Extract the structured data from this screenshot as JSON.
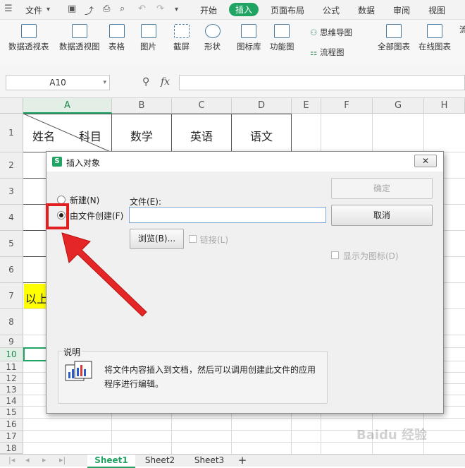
{
  "menu": {
    "file": "文件",
    "tabs": [
      "开始",
      "插入",
      "页面布局",
      "公式",
      "数据",
      "审阅",
      "视图"
    ],
    "active_tab": "插入"
  },
  "ribbon": {
    "pivot_table": "数据透视表",
    "pivot_chart": "数据透视图",
    "table": "表格",
    "picture": "图片",
    "screenshot": "截屏",
    "shapes": "形状",
    "icon_library": "图标库",
    "function_chart": "功能图",
    "mind_map": "思维导图",
    "flowchart": "流程图",
    "all_charts": "全部图表",
    "online_charts": "在线图表",
    "cut_off": "流"
  },
  "formula_bar": {
    "name_box": "A10",
    "fx": "fx"
  },
  "grid": {
    "columns": [
      "A",
      "B",
      "C",
      "D",
      "E",
      "F",
      "G",
      "H"
    ],
    "rows": [
      "1",
      "2",
      "3",
      "4",
      "5",
      "6",
      "7",
      "8",
      "9",
      "10",
      "11",
      "12",
      "13",
      "14",
      "15",
      "16",
      "17",
      "18"
    ],
    "a1_left": "姓名",
    "a1_right": "科目",
    "b1": "数学",
    "c1": "英语",
    "d1": "语文",
    "a7": "以上"
  },
  "dialog": {
    "title": "插入对象",
    "radio_new": "新建(N)",
    "radio_from_file": "由文件创建(F)",
    "file_label": "文件(E):",
    "file_value": "",
    "ok": "确定",
    "cancel": "取消",
    "browse": "浏览(B)...",
    "link": "链接(L)",
    "show_as_icon": "显示为图标(D)",
    "desc_title": "说明",
    "desc_text_1": "将文件内容插入到文档，然后可以调用创建此文件的应用",
    "desc_text_2": "程序进行编辑。"
  },
  "sheets": {
    "tabs": [
      "Sheet1",
      "Sheet2",
      "Sheet3"
    ],
    "active": "Sheet1",
    "add": "+"
  },
  "watermark": "Baidu 经验",
  "colors": {
    "accent": "#1fa463",
    "annotation": "#e02020",
    "highlight": "#ffff00"
  }
}
